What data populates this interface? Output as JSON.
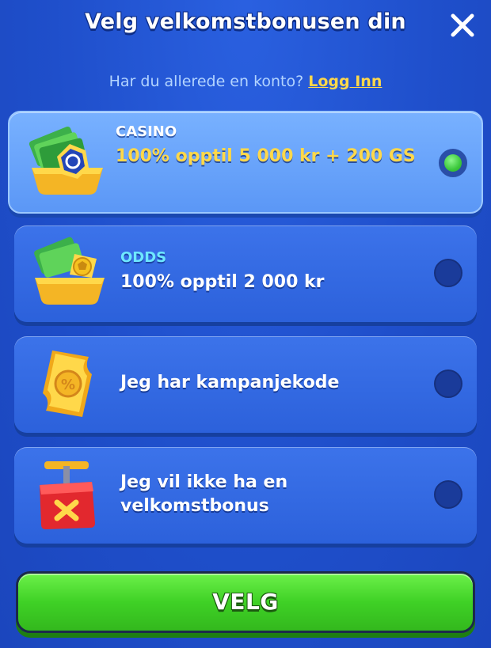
{
  "header": {
    "title": "Velg velkomstbonusen din",
    "close_icon": "close-icon"
  },
  "login": {
    "prompt": "Har du allerede en konto?",
    "link_label": "Logg Inn"
  },
  "options": [
    {
      "category": "CASINO",
      "description": "100% opptil 5 000 kr + 200 GS",
      "selected": true,
      "icon": "casino-cash-chest-icon"
    },
    {
      "category": "ODDS",
      "description": "100% opptil 2 000 kr",
      "selected": false,
      "icon": "odds-cash-chest-icon"
    },
    {
      "category": "",
      "description": "Jeg har kampanjekode",
      "selected": false,
      "icon": "promo-code-ticket-icon"
    },
    {
      "category": "",
      "description": "Jeg vil ikke ha en velkomstbonus",
      "selected": false,
      "icon": "no-bonus-detonator-icon"
    }
  ],
  "cta": {
    "label": "VELG"
  },
  "colors": {
    "background": "#1f51cf",
    "card": "#2c61db",
    "card_selected": "#5b97f6",
    "accent_gold": "#ffd84a",
    "accent_cyan": "#6ee8ff",
    "cta_green": "#3fd126"
  }
}
